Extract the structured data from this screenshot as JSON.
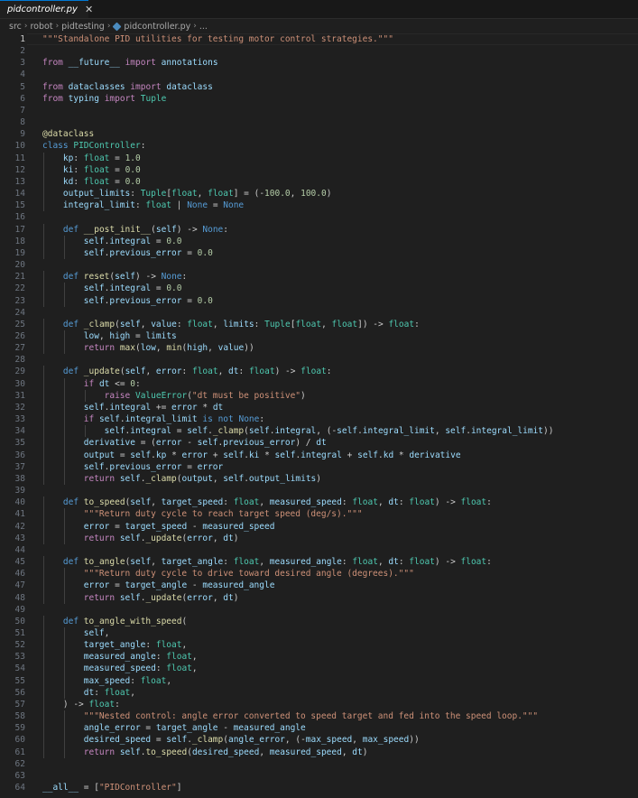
{
  "tab": {
    "label": "pidcontroller.py",
    "close": "✕"
  },
  "breadcrumb": {
    "items": [
      "src",
      "robot",
      "pidtesting",
      "pidcontroller.py",
      "..."
    ]
  },
  "editor": {
    "current_line": 1,
    "lines": [
      {
        "n": "1",
        "t": "\"\"\"Standalone PID utilities for testing motor control strategies.\"\"\""
      },
      {
        "n": "2",
        "t": ""
      },
      {
        "n": "3",
        "t": "from __future__ import annotations"
      },
      {
        "n": "4",
        "t": ""
      },
      {
        "n": "5",
        "t": "from dataclasses import dataclass"
      },
      {
        "n": "6",
        "t": "from typing import Tuple"
      },
      {
        "n": "7",
        "t": ""
      },
      {
        "n": "8",
        "t": ""
      },
      {
        "n": "9",
        "t": "@dataclass"
      },
      {
        "n": "10",
        "t": "class PIDController:"
      },
      {
        "n": "11",
        "t": "    kp: float = 1.0"
      },
      {
        "n": "12",
        "t": "    ki: float = 0.0"
      },
      {
        "n": "13",
        "t": "    kd: float = 0.0"
      },
      {
        "n": "14",
        "t": "    output_limits: Tuple[float, float] = (-100.0, 100.0)"
      },
      {
        "n": "15",
        "t": "    integral_limit: float | None = None"
      },
      {
        "n": "16",
        "t": ""
      },
      {
        "n": "17",
        "t": "    def __post_init__(self) -> None:"
      },
      {
        "n": "18",
        "t": "        self.integral = 0.0"
      },
      {
        "n": "19",
        "t": "        self.previous_error = 0.0"
      },
      {
        "n": "20",
        "t": ""
      },
      {
        "n": "21",
        "t": "    def reset(self) -> None:"
      },
      {
        "n": "22",
        "t": "        self.integral = 0.0"
      },
      {
        "n": "23",
        "t": "        self.previous_error = 0.0"
      },
      {
        "n": "24",
        "t": ""
      },
      {
        "n": "25",
        "t": "    def _clamp(self, value: float, limits: Tuple[float, float]) -> float:"
      },
      {
        "n": "26",
        "t": "        low, high = limits"
      },
      {
        "n": "27",
        "t": "        return max(low, min(high, value))"
      },
      {
        "n": "28",
        "t": ""
      },
      {
        "n": "29",
        "t": "    def _update(self, error: float, dt: float) -> float:"
      },
      {
        "n": "30",
        "t": "        if dt <= 0:"
      },
      {
        "n": "31",
        "t": "            raise ValueError(\"dt must be positive\")"
      },
      {
        "n": "32",
        "t": "        self.integral += error * dt"
      },
      {
        "n": "33",
        "t": "        if self.integral_limit is not None:"
      },
      {
        "n": "34",
        "t": "            self.integral = self._clamp(self.integral, (-self.integral_limit, self.integral_limit))"
      },
      {
        "n": "35",
        "t": "        derivative = (error - self.previous_error) / dt"
      },
      {
        "n": "36",
        "t": "        output = self.kp * error + self.ki * self.integral + self.kd * derivative"
      },
      {
        "n": "37",
        "t": "        self.previous_error = error"
      },
      {
        "n": "38",
        "t": "        return self._clamp(output, self.output_limits)"
      },
      {
        "n": "39",
        "t": ""
      },
      {
        "n": "40",
        "t": "    def to_speed(self, target_speed: float, measured_speed: float, dt: float) -> float:"
      },
      {
        "n": "41",
        "t": "        \"\"\"Return duty cycle to reach target speed (deg/s).\"\"\""
      },
      {
        "n": "42",
        "t": "        error = target_speed - measured_speed"
      },
      {
        "n": "43",
        "t": "        return self._update(error, dt)"
      },
      {
        "n": "44",
        "t": ""
      },
      {
        "n": "45",
        "t": "    def to_angle(self, target_angle: float, measured_angle: float, dt: float) -> float:"
      },
      {
        "n": "46",
        "t": "        \"\"\"Return duty cycle to drive toward desired angle (degrees).\"\"\""
      },
      {
        "n": "47",
        "t": "        error = target_angle - measured_angle"
      },
      {
        "n": "48",
        "t": "        return self._update(error, dt)"
      },
      {
        "n": "49",
        "t": ""
      },
      {
        "n": "50",
        "t": "    def to_angle_with_speed("
      },
      {
        "n": "51",
        "t": "        self,"
      },
      {
        "n": "52",
        "t": "        target_angle: float,"
      },
      {
        "n": "53",
        "t": "        measured_angle: float,"
      },
      {
        "n": "54",
        "t": "        measured_speed: float,"
      },
      {
        "n": "55",
        "t": "        max_speed: float,"
      },
      {
        "n": "56",
        "t": "        dt: float,"
      },
      {
        "n": "57",
        "t": "    ) -> float:"
      },
      {
        "n": "58",
        "t": "        \"\"\"Nested control: angle error converted to speed target and fed into the speed loop.\"\"\""
      },
      {
        "n": "59",
        "t": "        angle_error = target_angle - measured_angle"
      },
      {
        "n": "60",
        "t": "        desired_speed = self._clamp(angle_error, (-max_speed, max_speed))"
      },
      {
        "n": "61",
        "t": "        return self.to_speed(desired_speed, measured_speed, dt)"
      },
      {
        "n": "62",
        "t": ""
      },
      {
        "n": "63",
        "t": ""
      },
      {
        "n": "64",
        "t": "__all__ = [\"PIDController\"]"
      }
    ]
  }
}
